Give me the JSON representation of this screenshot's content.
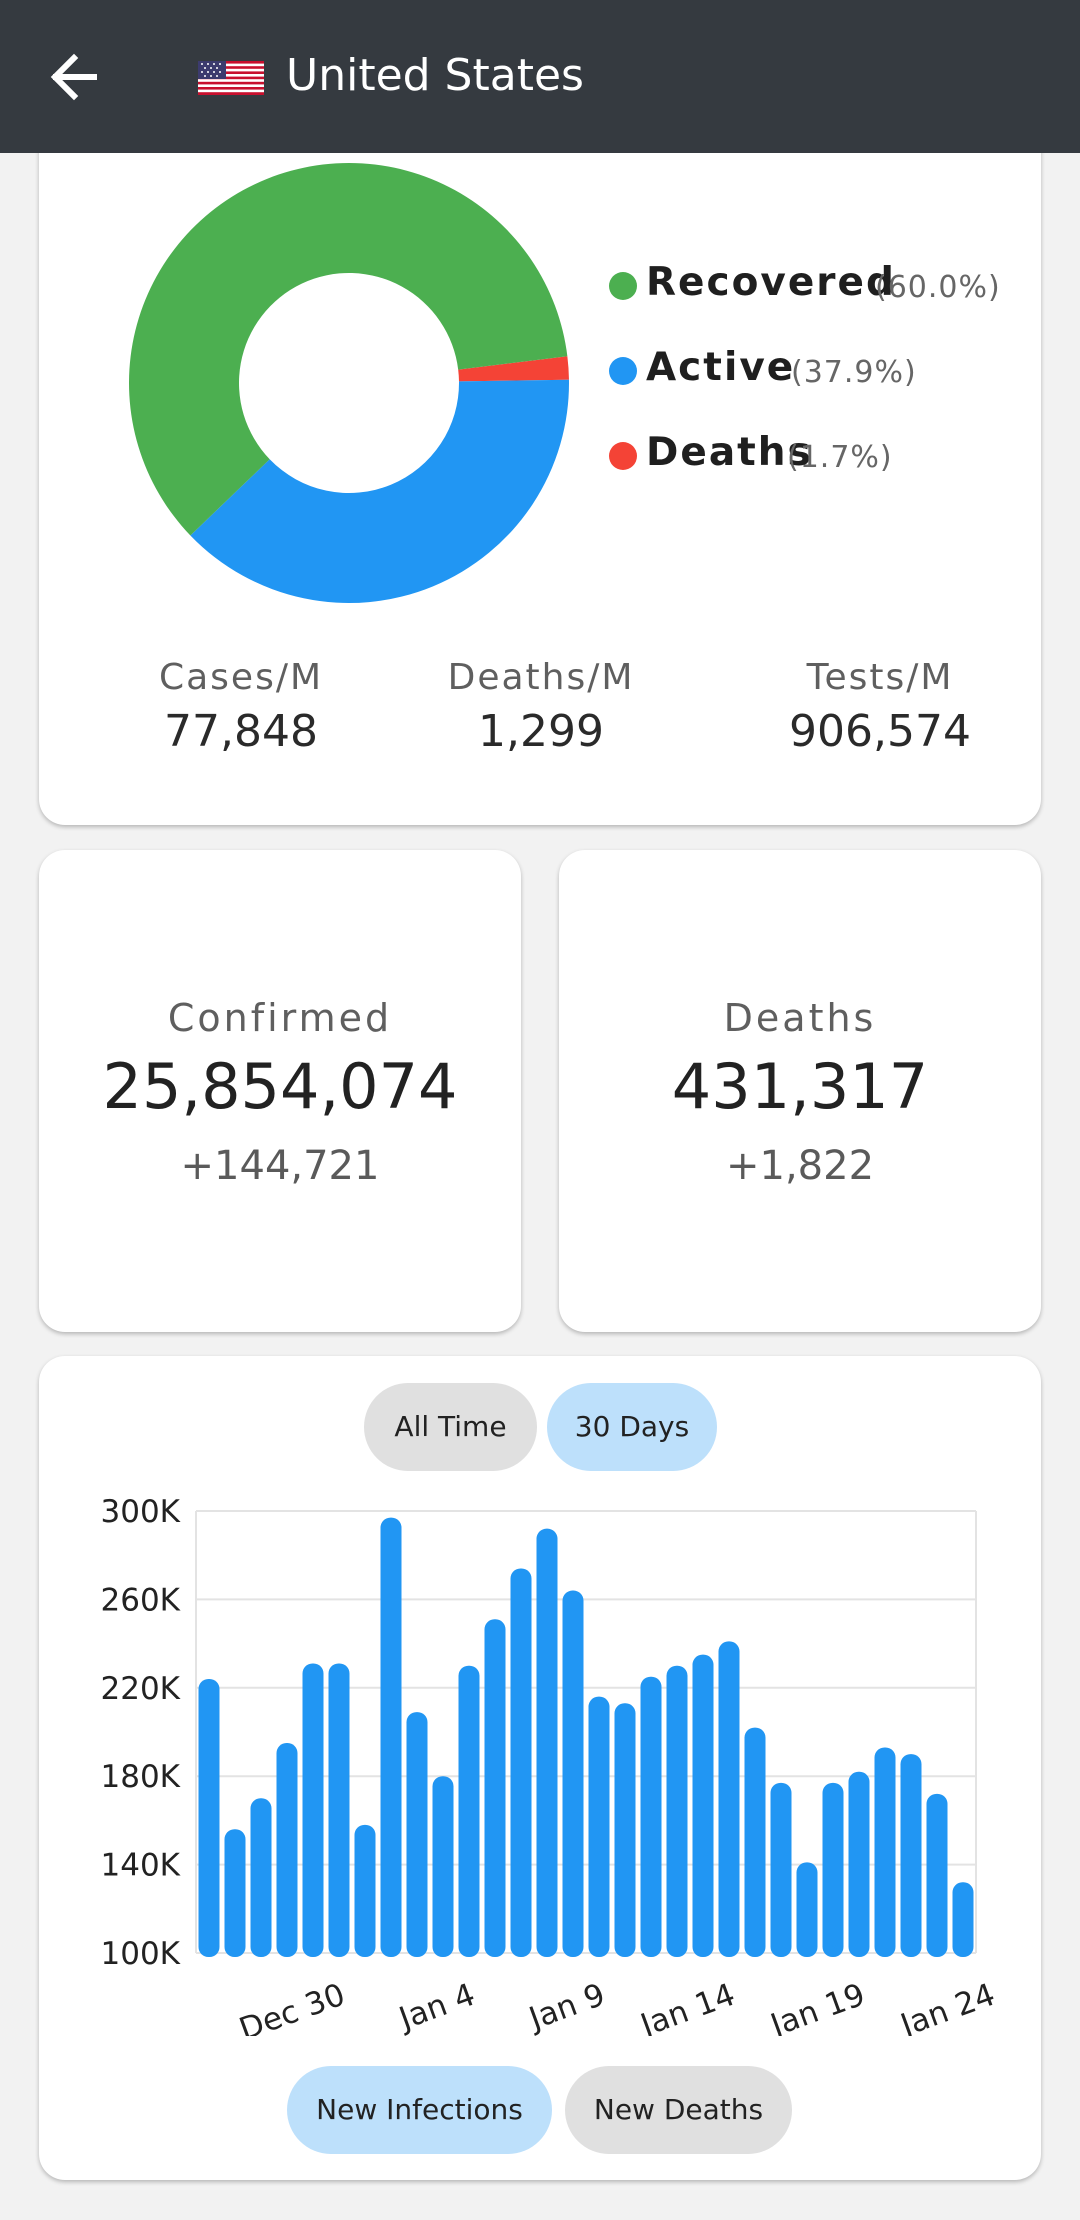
{
  "header": {
    "back_icon": "arrow-left-icon",
    "flag_icon": "us-flag-icon",
    "title": "United States"
  },
  "distribution": {
    "colors": {
      "recovered": "#4caf50",
      "active": "#2196f3",
      "deaths": "#f44336"
    },
    "legend": [
      {
        "label": "Recovered",
        "pct": "(60.0%)",
        "value": 60.0,
        "color": "#4caf50"
      },
      {
        "label": "Active",
        "pct": "(37.9%)",
        "value": 37.9,
        "color": "#2196f3"
      },
      {
        "label": "Deaths",
        "pct": "(1.7%)",
        "value": 1.7,
        "color": "#f44336"
      }
    ]
  },
  "per_million": [
    {
      "label": "Cases/M",
      "value": "77,848"
    },
    {
      "label": "Deaths/M",
      "value": "1,299"
    },
    {
      "label": "Tests/M",
      "value": "906,574"
    }
  ],
  "confirmed": {
    "label": "Confirmed",
    "value": "25,854,074",
    "delta": "+144,721"
  },
  "deaths": {
    "label": "Deaths",
    "value": "431,317",
    "delta": "+1,822"
  },
  "range_tabs": [
    {
      "label": "All Time",
      "active": false
    },
    {
      "label": "30 Days",
      "active": true
    }
  ],
  "metric_tabs": [
    {
      "label": "New Infections",
      "active": true
    },
    {
      "label": "New Deaths",
      "active": false
    }
  ],
  "chart_data": {
    "type": "bar",
    "bar_color": "#2196f3",
    "ylim": [
      100000,
      300000
    ],
    "yticks": [
      "100K",
      "140K",
      "180K",
      "220K",
      "260K",
      "300K"
    ],
    "xticks": [
      "Dec 30",
      "Jan 4",
      "Jan 9",
      "Jan 14",
      "Jan 19",
      "Jan 24"
    ],
    "series": [
      {
        "values": [
          224000,
          156000,
          170000,
          195000,
          231000,
          231000,
          158000,
          297000,
          209000,
          180000,
          230000,
          251000,
          274000,
          292000,
          264000,
          216000,
          213000,
          225000,
          230000,
          235000,
          241000,
          202000,
          177000,
          141000,
          177000,
          182000,
          193000,
          190000,
          172000,
          132000
        ]
      }
    ]
  }
}
